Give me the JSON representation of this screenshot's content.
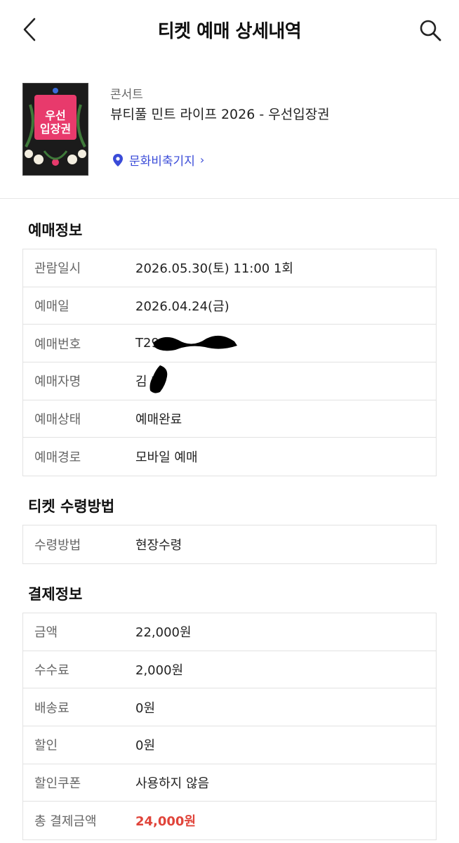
{
  "header": {
    "title": "티켓 예매 상세내역",
    "back_icon": "chevron-left-icon",
    "search_icon": "search-icon"
  },
  "event": {
    "category": "콘서트",
    "title": "뷰티풀 민트 라이프 2026 - 우선입장권",
    "poster_text_line1": "우선",
    "poster_text_line2": "입장권",
    "venue": "문화비축기지",
    "venue_icon": "location-pin-icon",
    "venue_chevron": "›"
  },
  "reservation": {
    "title": "예매정보",
    "rows": [
      {
        "label": "관람일시",
        "value": "2026.05.30(토) 11:00 1회"
      },
      {
        "label": "예매일",
        "value": "2026.04.24(금)"
      },
      {
        "label": "예매번호",
        "value": "T29"
      },
      {
        "label": "예매자명",
        "value": "김 희"
      },
      {
        "label": "예매상태",
        "value": "예매완료"
      },
      {
        "label": "예매경로",
        "value": "모바일 예매"
      }
    ]
  },
  "receipt": {
    "title": "티켓 수령방법",
    "rows": [
      {
        "label": "수령방법",
        "value": "현장수령"
      }
    ]
  },
  "payment": {
    "title": "결제정보",
    "rows": [
      {
        "label": "금액",
        "value": "22,000원"
      },
      {
        "label": "수수료",
        "value": "2,000원"
      },
      {
        "label": "배송료",
        "value": "0원"
      },
      {
        "label": "할인",
        "value": "0원"
      },
      {
        "label": "할인쿠폰",
        "value": "사용하지 않음"
      },
      {
        "label": "총 결제금액",
        "value": "24,000원"
      }
    ]
  },
  "colors": {
    "accent_blue": "#3a4bd8",
    "total_red": "#e0443a",
    "poster_bg": "#1b1b1b",
    "poster_pink": "#e83a6c"
  }
}
